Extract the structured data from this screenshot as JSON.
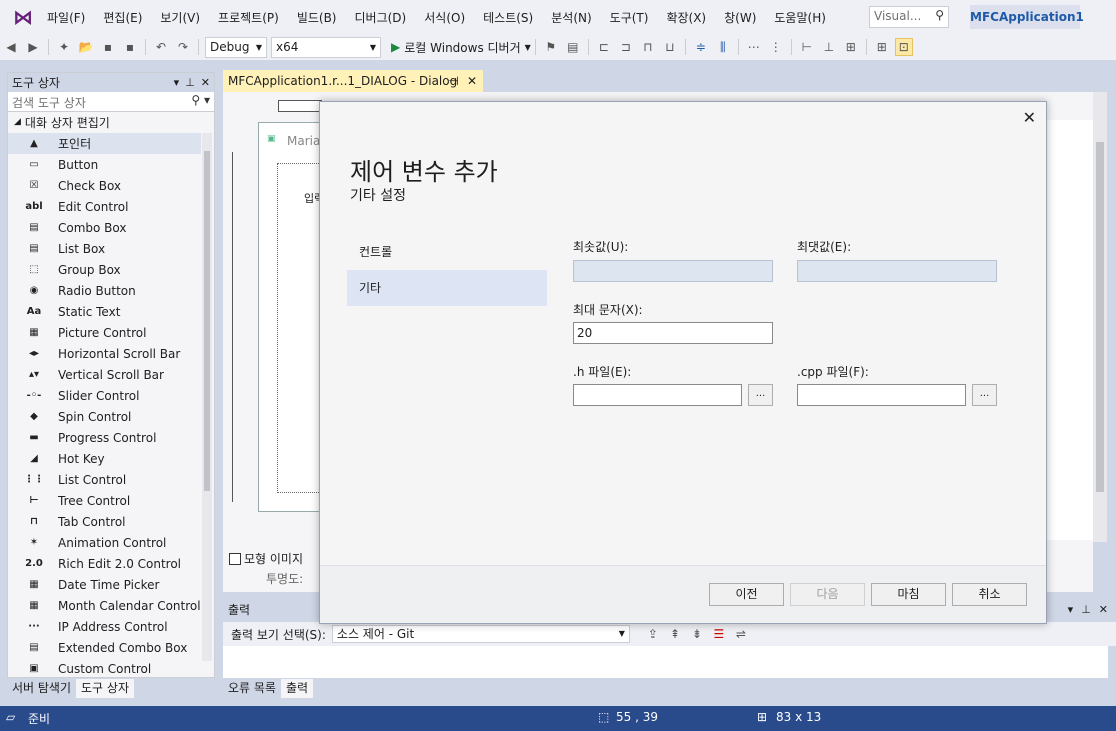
{
  "menubar": {
    "items": [
      "파일(F)",
      "편집(E)",
      "보기(V)",
      "프로젝트(P)",
      "빌드(B)",
      "디버그(D)",
      "서식(O)",
      "테스트(S)",
      "분석(N)",
      "도구(T)",
      "확장(X)",
      "창(W)",
      "도움말(H)"
    ],
    "search_placeholder": "Visual...",
    "app_title": "MFCApplication1"
  },
  "toolbar": {
    "config": "Debug",
    "platform": "x64",
    "run_label": "로컬 Windows 디버거"
  },
  "toolbox": {
    "title": "도구 상자",
    "search_placeholder": "검색 도구 상자",
    "group": "대화 상자 편집기",
    "items": [
      {
        "label": "포인터",
        "icon": "▲"
      },
      {
        "label": "Button",
        "icon": "▭"
      },
      {
        "label": "Check Box",
        "icon": "☒"
      },
      {
        "label": "Edit Control",
        "icon": "abl"
      },
      {
        "label": "Combo Box",
        "icon": "▤"
      },
      {
        "label": "List Box",
        "icon": "▤"
      },
      {
        "label": "Group Box",
        "icon": "⬚"
      },
      {
        "label": "Radio Button",
        "icon": "◉"
      },
      {
        "label": "Static Text",
        "icon": "Aa"
      },
      {
        "label": "Picture Control",
        "icon": "▦"
      },
      {
        "label": "Horizontal Scroll Bar",
        "icon": "◂▸"
      },
      {
        "label": "Vertical Scroll Bar",
        "icon": "▴▾"
      },
      {
        "label": "Slider Control",
        "icon": "-◦-"
      },
      {
        "label": "Spin Control",
        "icon": "◆"
      },
      {
        "label": "Progress Control",
        "icon": "▬"
      },
      {
        "label": "Hot Key",
        "icon": "◢"
      },
      {
        "label": "List Control",
        "icon": "⋮⋮"
      },
      {
        "label": "Tree Control",
        "icon": "⊢"
      },
      {
        "label": "Tab Control",
        "icon": "⊓"
      },
      {
        "label": "Animation Control",
        "icon": "✶"
      },
      {
        "label": "Rich Edit 2.0 Control",
        "icon": "2.0"
      },
      {
        "label": "Date Time Picker",
        "icon": "▦"
      },
      {
        "label": "Month Calendar Control",
        "icon": "▦"
      },
      {
        "label": "IP Address Control",
        "icon": "···"
      },
      {
        "label": "Extended Combo Box",
        "icon": "▤"
      },
      {
        "label": "Custom Control",
        "icon": "▣"
      }
    ],
    "tabs": [
      "서버 탐색기",
      "도구 상자"
    ]
  },
  "document": {
    "tab_label": "MFCApplication1.r...1_DIALOG - Dialog",
    "dialog_title_partial": "Maria",
    "dialog_label_partial": "입력",
    "mock_checkbox": "모형 이미지",
    "transparency": "투명도:"
  },
  "output": {
    "title": "출력",
    "show_label": "출력 보기 선택(S):",
    "show_value": "소스 제어 - Git",
    "tabs": [
      "오류 목록",
      "출력"
    ]
  },
  "status": {
    "ready": "준비",
    "position": "55 , 39",
    "size": "83 x 13"
  },
  "wizard": {
    "title": "제어 변수 추가",
    "subtitle": "기타 설정",
    "nav": [
      "컨트롤",
      "기타"
    ],
    "min_label": "최솟값(U):",
    "min_value": "",
    "max_label": "최댓값(E):",
    "max_value": "",
    "maxchars_label": "최대 문자(X):",
    "maxchars_value": "20",
    "h_label": ".h 파일(E):",
    "h_value": "",
    "cpp_label": ".cpp 파일(F):",
    "cpp_value": "",
    "browse": "...",
    "buttons": {
      "prev": "이전",
      "next": "다음",
      "finish": "마침",
      "cancel": "취소"
    }
  }
}
